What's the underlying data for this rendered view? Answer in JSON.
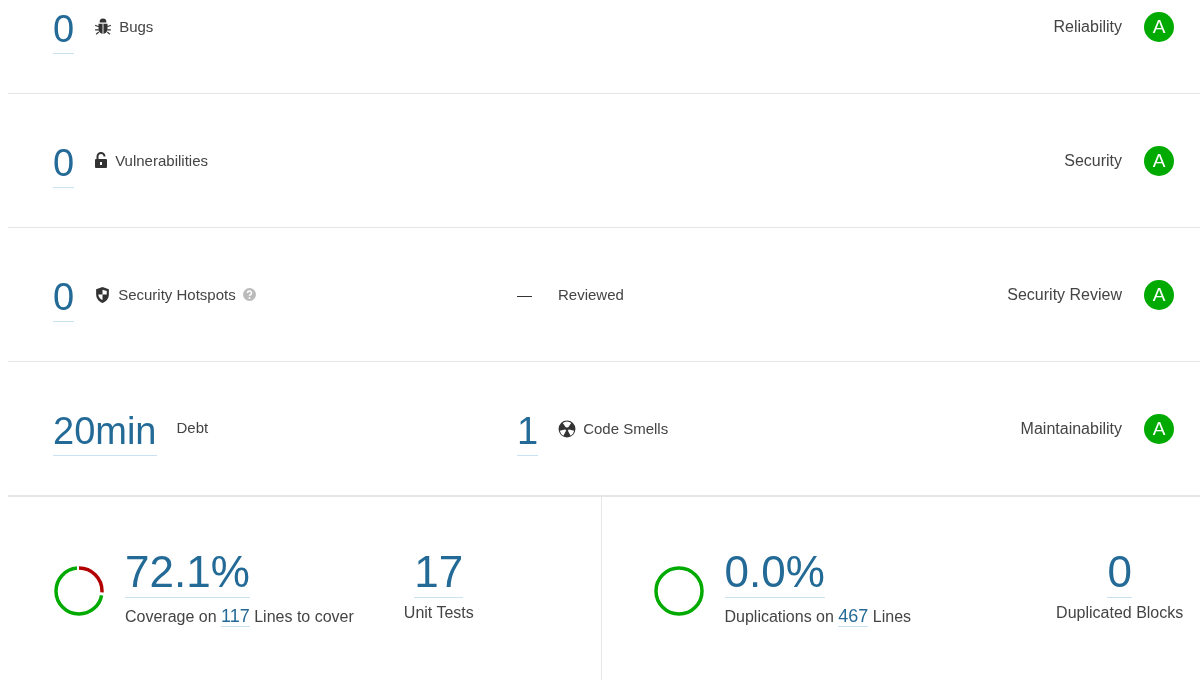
{
  "measures": [
    {
      "main": {
        "value": "0",
        "label": "Bugs",
        "kind": "bug"
      },
      "rating_label": "Reliability",
      "rating": "A"
    },
    {
      "main": {
        "value": "0",
        "label": "Vulnerabilities",
        "kind": "lock"
      },
      "rating_label": "Security",
      "rating": "A"
    },
    {
      "main": {
        "value": "0",
        "label": "Security Hotspots",
        "kind": "shield",
        "help": true
      },
      "secondary": {
        "value": "—",
        "label": "Reviewed",
        "kind": "dash"
      },
      "rating_label": "Security Review",
      "rating": "A"
    },
    {
      "main": {
        "value": "20min",
        "label": "Debt",
        "kind": "plain"
      },
      "secondary": {
        "value": "1",
        "label": "Code Smells",
        "kind": "smell"
      },
      "rating_label": "Maintainability",
      "rating": "A"
    }
  ],
  "panels": [
    {
      "kind": "coverage",
      "value": "72.1%",
      "label_before": "Coverage on",
      "link": "117",
      "label_after": "Lines to cover",
      "side_value": "17",
      "side_label": "Unit Tests"
    },
    {
      "kind": "duplications",
      "value": "0.0%",
      "label_before": "Duplications on",
      "link": "467",
      "label_after": "Lines",
      "side_value": "0",
      "side_label": "Duplicated Blocks"
    }
  ]
}
